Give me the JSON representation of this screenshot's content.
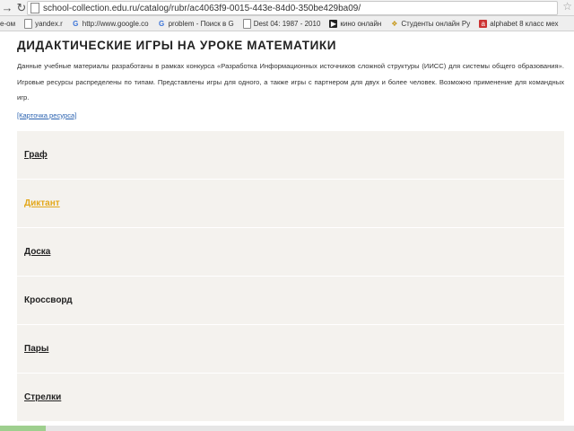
{
  "browser": {
    "url": "school-collection.edu.ru/catalog/rubr/ac4063f9-0015-443e-84d0-350be429ba09/",
    "bookmarks": [
      {
        "label": "е-ом",
        "icon": "page-icon"
      },
      {
        "label": "yandex.r",
        "icon": "page-icon"
      },
      {
        "label": "http://www.google.co",
        "icon": "google-icon"
      },
      {
        "label": "problem - Поиск в G",
        "icon": "google-icon"
      },
      {
        "label": "Dest 04: 1987 - 2010",
        "icon": "page-icon"
      },
      {
        "label": "кино онлайн",
        "icon": "film-icon"
      },
      {
        "label": "Студенты онлайн Ру",
        "icon": "folder-icon"
      },
      {
        "label": "alphabet 8 класс мех",
        "icon": "bookmark-icon"
      }
    ]
  },
  "page": {
    "title": "ДИДАКТИЧЕСКИЕ ИГРЫ НА УРОКЕ МАТЕМАТИКИ",
    "description": "Данные учебные материалы разработаны в рамках конкурса «Разработка Информационных источников сложной структуры (ИИСС) для системы общего образования». Игровые ресурсы распределены по типам. Представлены игры для одного, а также игры с партнером для двух и более человек. Возможно применение для командных игр.",
    "card_link": "[Карточка ресурса]"
  },
  "items": [
    {
      "label": "Граф",
      "state": "link"
    },
    {
      "label": "Диктант",
      "state": "hover"
    },
    {
      "label": "Доска",
      "state": "link"
    },
    {
      "label": "Кроссворд",
      "state": "plain"
    },
    {
      "label": "Пары",
      "state": "link"
    },
    {
      "label": "Стрелки",
      "state": "link"
    }
  ],
  "status": {
    "progress": 0.08
  },
  "colors": {
    "hover_link": "#e3a81c",
    "list_bg": "#f4f2ee",
    "link_blue": "#2a62b0"
  }
}
